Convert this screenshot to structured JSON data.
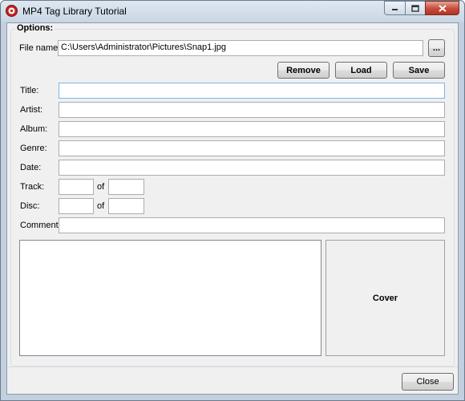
{
  "window": {
    "title": "MP4 Tag Library Tutorial"
  },
  "options": {
    "group_label": "Options:",
    "file_name_label": "File name:",
    "file_name_value": "C:\\Users\\Administrator\\Pictures\\Snap1.jpg",
    "browse_label": "...",
    "remove_label": "Remove",
    "load_label": "Load",
    "save_label": "Save"
  },
  "fields": {
    "title_label": "Title:",
    "artist_label": "Artist:",
    "album_label": "Album:",
    "genre_label": "Genre:",
    "date_label": "Date:",
    "track_label": "Track:",
    "track_of_label": "of",
    "disc_label": "Disc:",
    "disc_of_label": "of",
    "comment_label": "Comment:"
  },
  "cover": {
    "label": "Cover"
  },
  "footer": {
    "close_label": "Close"
  },
  "icons": {
    "app": "app-icon",
    "minimize": "minimize-icon",
    "maximize": "maximize-icon",
    "close": "close-icon"
  }
}
